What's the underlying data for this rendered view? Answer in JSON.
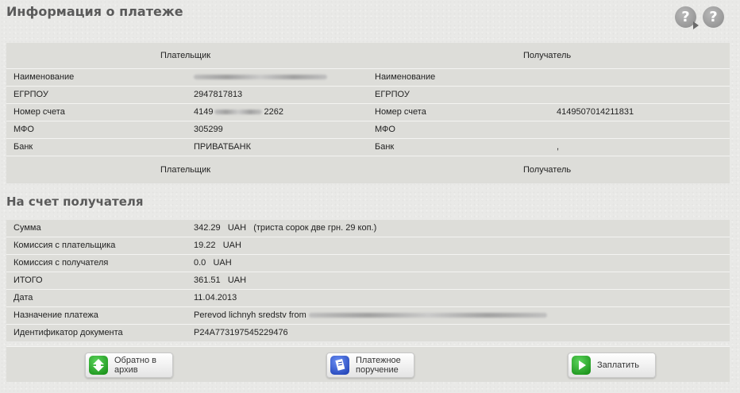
{
  "header": {
    "title": "Информация о платеже"
  },
  "help_icons": [
    "help-icon",
    "help-icon"
  ],
  "parties": {
    "payer_header": "Плательщик",
    "recipient_header": "Получатель",
    "rows": [
      {
        "label": "Наименование",
        "payer_value": "",
        "payer_blurred": true,
        "recipient_label": "Наименование",
        "recipient_value": ""
      },
      {
        "label": "ЕГРПОУ",
        "payer_value": "2947817813",
        "recipient_label": "ЕГРПОУ",
        "recipient_value": ""
      },
      {
        "label": "Номер счета",
        "payer_value_prefix": "4149",
        "payer_value_suffix": "2262",
        "recipient_label": "Номер счета",
        "recipient_value": "4149507014211831"
      },
      {
        "label": "МФО",
        "payer_value": "305299",
        "recipient_label": "МФО",
        "recipient_value": ""
      },
      {
        "label": "Банк",
        "payer_value": "ПРИВАТБАНК",
        "recipient_label": "Банк",
        "recipient_value": ","
      }
    ],
    "payer_footer": "Плательщик",
    "recipient_footer": "Получатель"
  },
  "details": {
    "title": "На счет получателя",
    "rows": [
      {
        "label": "Сумма",
        "value": "342.29   UAH   (триста сорок две грн. 29 коп.)"
      },
      {
        "label": "Комиссия с плательщика",
        "value": "19.22   UAH"
      },
      {
        "label": "Комиссия с получателя",
        "value": "0.0   UAH"
      },
      {
        "label": "ИТОГО",
        "value": "361.51   UAH"
      },
      {
        "label": "Дата",
        "value": "11.04.2013"
      },
      {
        "label": "Назначение платежа",
        "value": "Perevod lichnyh sredstv from"
      },
      {
        "label": "Идентификатор документа",
        "value": "P24A773197545229476"
      }
    ]
  },
  "buttons": {
    "back": {
      "line1": "Обратно в",
      "line2": "архив",
      "icon": "up-arrow-icon"
    },
    "order": {
      "line1": "Платежное",
      "line2": "поручение",
      "icon": "document-icon"
    },
    "pay": {
      "label": "Заплатить",
      "icon": "play-icon"
    }
  },
  "colors": {
    "panel": "#ddddd9",
    "background": "#e9e9e7",
    "title": "#5a5a5a",
    "green": "#128a12",
    "blue": "#1a3bb0"
  }
}
